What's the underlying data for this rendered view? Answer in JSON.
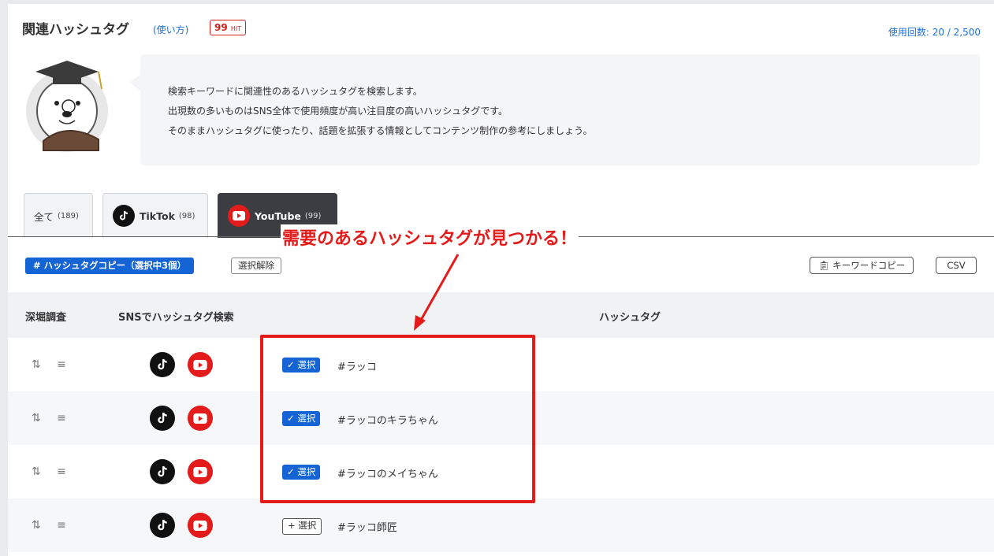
{
  "header": {
    "title": "関連ハッシュタグ",
    "howto_link": "(使い方)",
    "hit_count": "99",
    "hit_unit": "HIT",
    "usage": "使用回数: 20 / 2,500"
  },
  "description": {
    "lines": [
      "検索キーワードに関連性のあるハッシュタグを検索します。",
      "出現数の多いものはSNS全体で使用頻度が高い注目度の高いハッシュタグです。",
      "そのままハッシュタグに使ったり、話題を拡張する情報としてコンテンツ制作の参考にしましょう。"
    ]
  },
  "tabs": [
    {
      "label": "全て",
      "count": "(189)",
      "active": false
    },
    {
      "label": "TikTok",
      "count": "(98)",
      "active": false
    },
    {
      "label": "YouTube",
      "count": "(99)",
      "active": true
    }
  ],
  "annotation": {
    "callout": "需要のあるハッシュタグが見つかる！",
    "color": "#e31b1b"
  },
  "toolbar": {
    "copy_label": "# ハッシュタグコピー（選択中3個）",
    "clear_label": "選択解除",
    "keyword_copy_label": "キーワードコピー",
    "csv_label": "CSV"
  },
  "table": {
    "headers": {
      "deep_dive": "深堀調査",
      "sns_search": "SNSでハッシュタグ検索",
      "hashtag": "ハッシュタグ"
    },
    "rows": [
      {
        "tag": "#ラッコ",
        "selected": true,
        "select_label": "✓ 選択"
      },
      {
        "tag": "#ラッコのキラちゃん",
        "selected": true,
        "select_label": "✓ 選択"
      },
      {
        "tag": "#ラッコのメイちゃん",
        "selected": true,
        "select_label": "✓ 選択"
      },
      {
        "tag": "#ラッコ師匠",
        "selected": false,
        "select_label": "+ 選択"
      }
    ],
    "row_tools": "⇅ ≡"
  },
  "colors": {
    "accent": "#1564d6",
    "link": "#1f6fd6",
    "youtube": "#e31b1b",
    "tiktok": "#111111"
  }
}
